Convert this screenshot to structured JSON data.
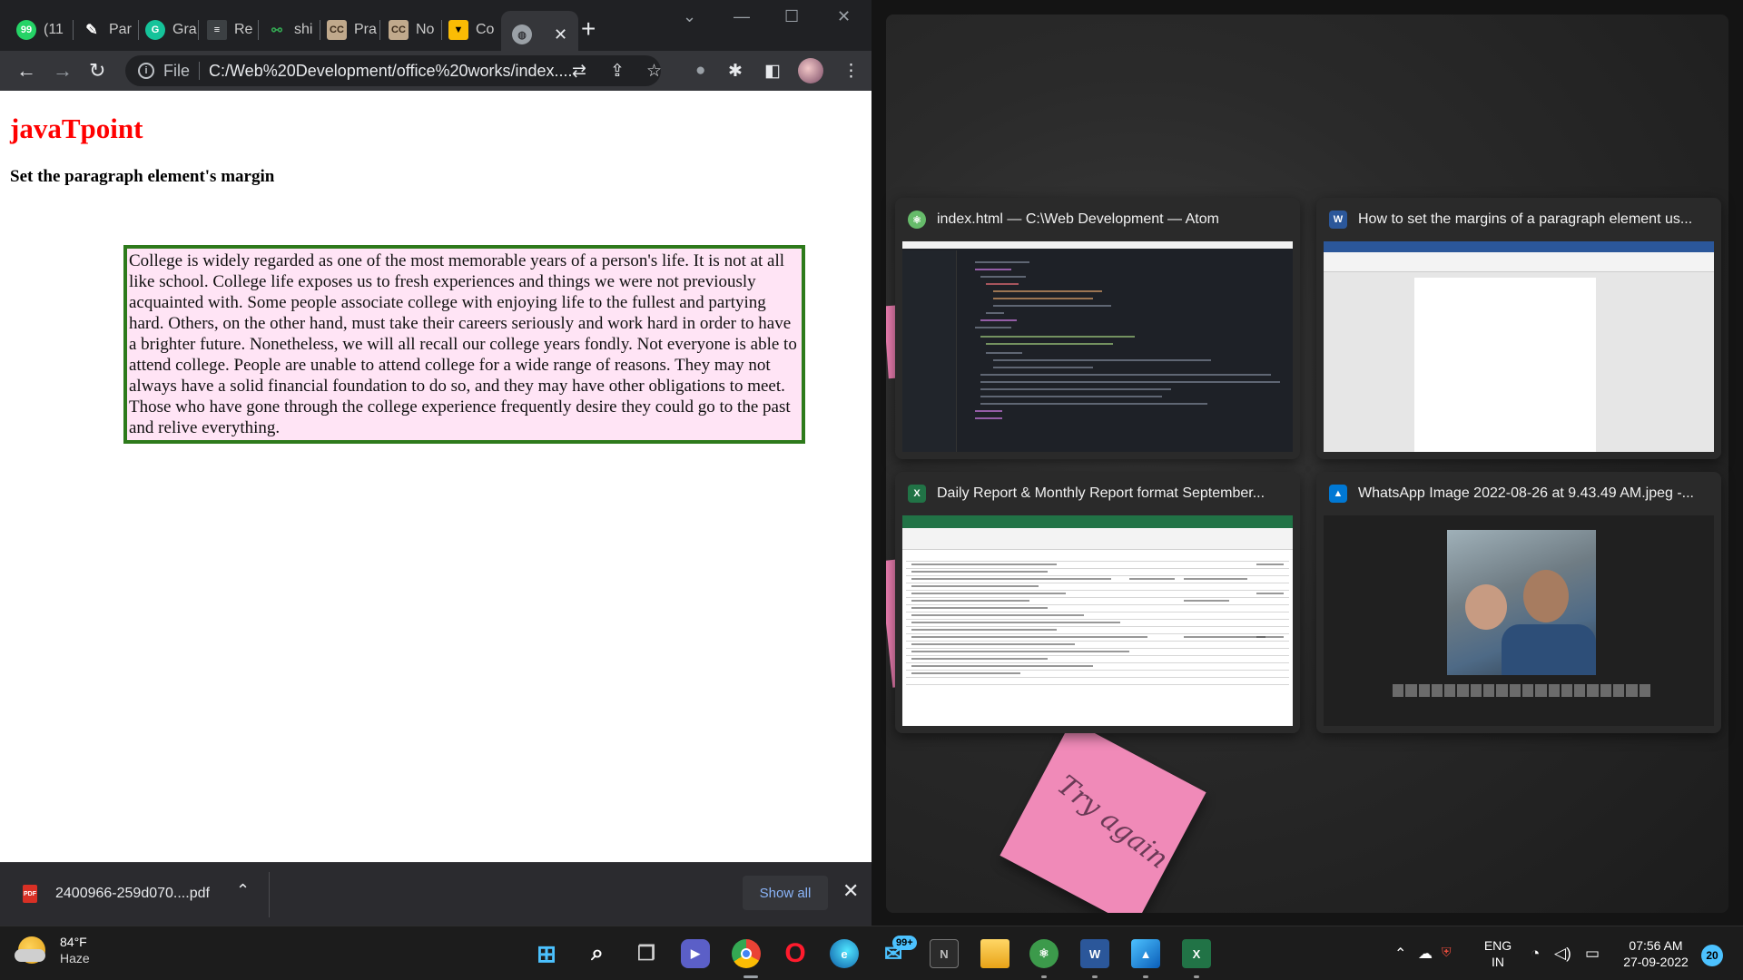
{
  "browser": {
    "tabs": [
      {
        "label": "(11",
        "icon": "whatsapp-icon",
        "color": "#25d366"
      },
      {
        "label": "Par",
        "icon": "feather-icon",
        "color": "#ffffff"
      },
      {
        "label": "Gra",
        "icon": "grammarly-icon",
        "color": "#15c39a"
      },
      {
        "label": "Re",
        "icon": "bars-icon",
        "color": "#4285f4"
      },
      {
        "label": "shi",
        "icon": "link-icon",
        "color": "#34a853"
      },
      {
        "label": "Pra",
        "icon": "cc-icon",
        "color": "#c0a98c"
      },
      {
        "label": "No",
        "icon": "cc-icon",
        "color": "#c0a98c"
      },
      {
        "label": "Co",
        "icon": "shield-icon",
        "color": "#fbbc04"
      }
    ],
    "active_tab_close": "✕",
    "new_tab": "+",
    "url_scheme": "File",
    "url": "C:/Web%20Development/office%20works/index....",
    "download": {
      "filename": "2400966-259d070....pdf",
      "show_all": "Show all"
    }
  },
  "page": {
    "heading": "javaTpoint",
    "subheading": "Set the paragraph element's margin",
    "paragraph": "College is widely regarded as one of the most memorable years of a person's life. It is not at all like school. College life exposes us to fresh experiences and things we were not previously acquainted with. Some people associate college with enjoying life to the fullest and partying hard. Others, on the other hand, must take their careers seriously and work hard in order to have a brighter future. Nonetheless, we will all recall our college years fondly. Not everyone is able to attend college. People are unable to attend college for a wide range of reasons. They may not always have a solid financial foundation to do so, and they may have other obligations to meet. Those who have gone through the college experience frequently desire they could go to the past and relive everything."
  },
  "snap_assist": {
    "windows": [
      {
        "title": "index.html — C:\\Web Development — Atom",
        "app": "atom"
      },
      {
        "title": "How to set the margins of a paragraph element us...",
        "app": "word"
      },
      {
        "title": "Daily Report & Monthly Report format September...",
        "app": "excel"
      },
      {
        "title": "WhatsApp Image 2022-08-26 at 9.43.49 AM.jpeg -...",
        "app": "photos"
      }
    ],
    "sticky_note_text": "Try again"
  },
  "taskbar": {
    "weather_temp": "84°F",
    "weather_condition": "Haze",
    "mail_badge": "99+",
    "language": "ENG",
    "region": "IN",
    "time": "07:56 AM",
    "date": "27-09-2022",
    "notification_count": "20"
  }
}
